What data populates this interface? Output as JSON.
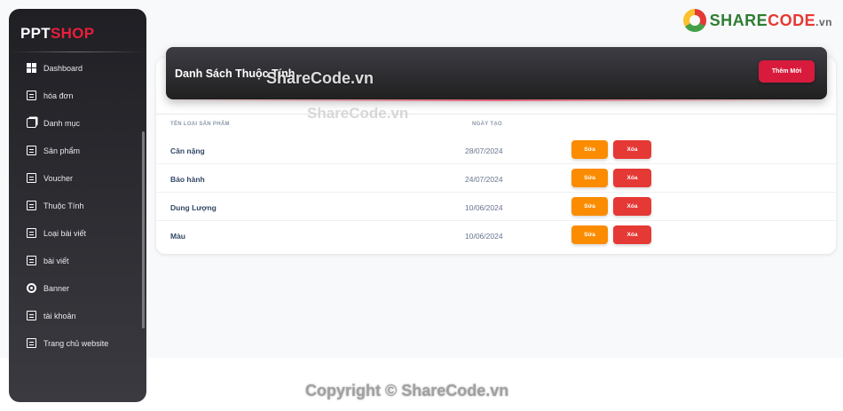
{
  "brand": {
    "part1": "PPT",
    "part2": "SHOP"
  },
  "corner_logo": {
    "part1": "SHARE",
    "part2": "CODE",
    "suffix": ".vn"
  },
  "sidebar": {
    "items": [
      {
        "label": "Dashboard",
        "icon": "dashboard-icon"
      },
      {
        "label": "hóa đơn",
        "icon": "receipt-icon"
      },
      {
        "label": "Danh mục",
        "icon": "category-icon"
      },
      {
        "label": "Sản phẩm",
        "icon": "product-icon"
      },
      {
        "label": "Voucher",
        "icon": "voucher-icon"
      },
      {
        "label": "Thuộc Tính",
        "icon": "attribute-icon"
      },
      {
        "label": "Loại bài viết",
        "icon": "post-type-icon"
      },
      {
        "label": "bài viết",
        "icon": "post-icon"
      },
      {
        "label": "Banner",
        "icon": "banner-icon"
      },
      {
        "label": "tài khoản",
        "icon": "account-icon"
      },
      {
        "label": "Trang chủ website",
        "icon": "home-icon"
      }
    ]
  },
  "card": {
    "title": "Danh Sách Thuộc Tính",
    "add_button": "Thêm Mới"
  },
  "table": {
    "headers": [
      "Tên loại sản phẩm",
      "Ngày tạo"
    ],
    "edit_label": "Sửa",
    "delete_label": "Xóa",
    "rows": [
      {
        "name": "Cân nặng",
        "date": "28/07/2024"
      },
      {
        "name": "Bảo hành",
        "date": "24/07/2024"
      },
      {
        "name": "Dung Lượng",
        "date": "10/06/2024"
      },
      {
        "name": "Màu",
        "date": "10/06/2024"
      }
    ]
  },
  "watermarks": [
    "ShareCode.vn",
    "ShareCode.vn",
    "Copyright © ShareCode.vn"
  ],
  "colors": {
    "accent": "#d81b3c",
    "edit": "#fb8c00",
    "delete": "#e53935",
    "sidebar": "#1f1f24"
  }
}
